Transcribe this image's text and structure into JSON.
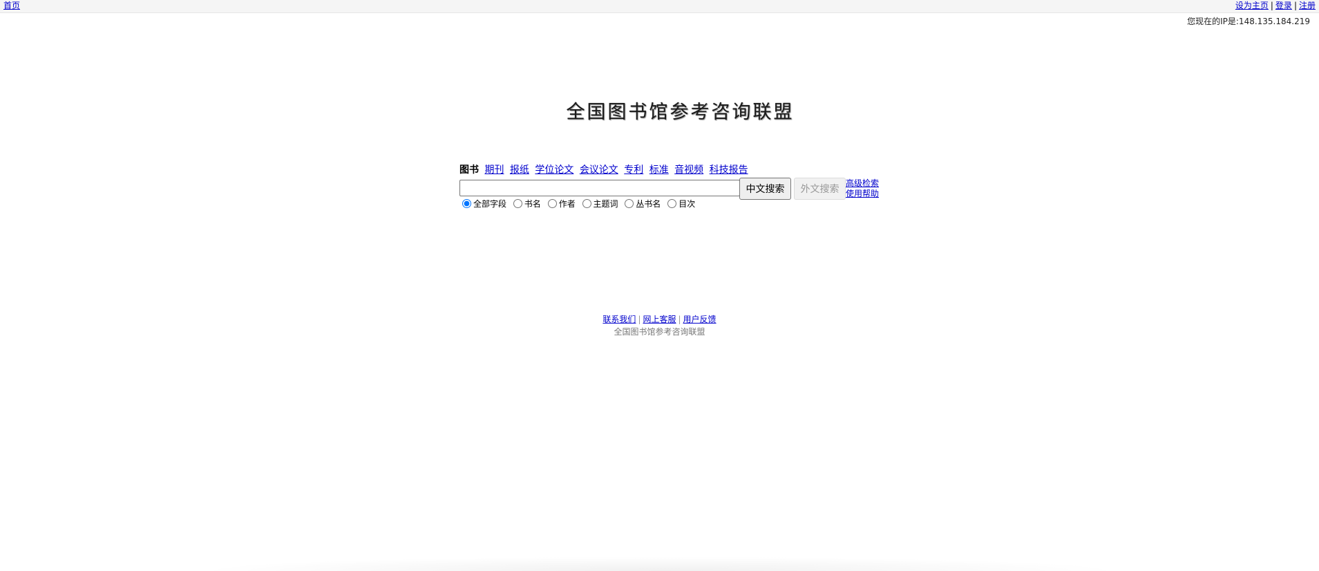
{
  "topbar": {
    "home": "首页",
    "set_homepage": "设为主页",
    "separator": "|",
    "login": "登录",
    "register": "注册"
  },
  "ip_text": "您现在的IP是:148.135.184.219",
  "logo_text": "全国图书馆参考咨询联盟",
  "tabs": [
    {
      "label": "图书",
      "active": true
    },
    {
      "label": "期刊",
      "active": false
    },
    {
      "label": "报纸",
      "active": false
    },
    {
      "label": "学位论文",
      "active": false
    },
    {
      "label": "会议论文",
      "active": false
    },
    {
      "label": "专利",
      "active": false
    },
    {
      "label": "标准",
      "active": false
    },
    {
      "label": "音视频",
      "active": false
    },
    {
      "label": "科技报告",
      "active": false
    }
  ],
  "search": {
    "value": "",
    "cn_button": "中文搜索",
    "foreign_button": "外文搜索",
    "advanced": "高级检索",
    "help": "使用帮助"
  },
  "radios": [
    {
      "label": "全部字段",
      "checked": true
    },
    {
      "label": "书名",
      "checked": false
    },
    {
      "label": "作者",
      "checked": false
    },
    {
      "label": "主题词",
      "checked": false
    },
    {
      "label": "丛书名",
      "checked": false
    },
    {
      "label": "目次",
      "checked": false
    }
  ],
  "footer": {
    "contact": "联系我们",
    "separator": "|",
    "online_service": "网上客服",
    "feedback": "用户反馈",
    "copyright": "全国图书馆参考咨询联盟"
  }
}
